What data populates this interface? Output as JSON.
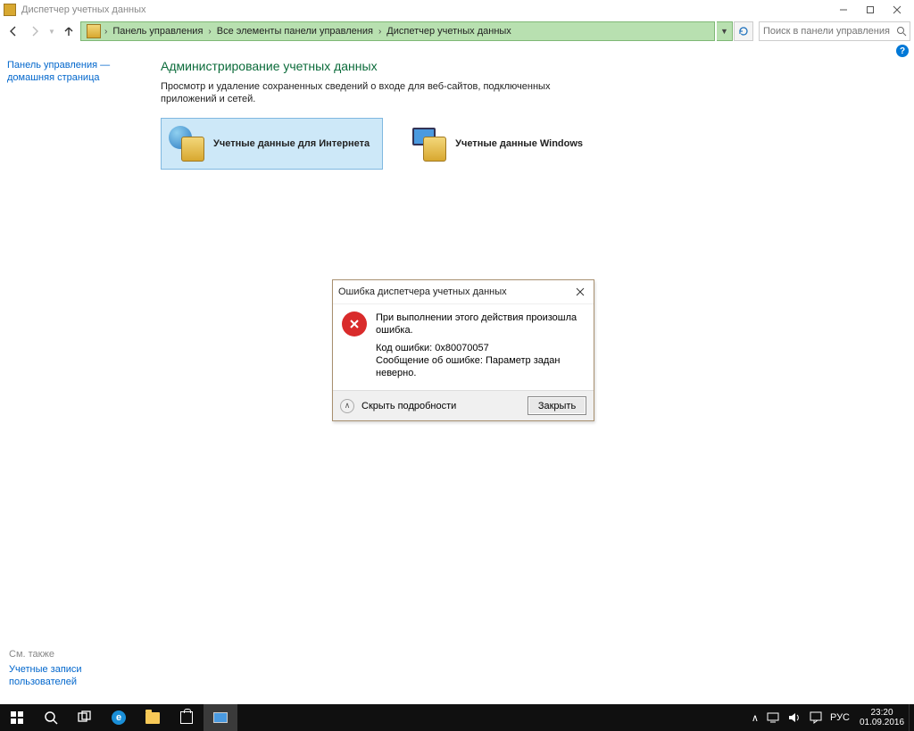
{
  "window": {
    "title": "Диспетчер учетных данных"
  },
  "breadcrumb": {
    "items": [
      "Панель управления",
      "Все элементы панели управления",
      "Диспетчер учетных данных"
    ]
  },
  "search": {
    "placeholder": "Поиск в панели управления"
  },
  "sidebar": {
    "home_line1": "Панель управления —",
    "home_line2": "домашняя страница",
    "seealso_label": "См. также",
    "seealso_link_line1": "Учетные записи",
    "seealso_link_line2": "пользователей"
  },
  "main": {
    "heading": "Администрирование учетных данных",
    "description": "Просмотр и удаление сохраненных сведений о входе для веб-сайтов, подключенных приложений и сетей.",
    "tiles": [
      {
        "label": "Учетные данные для Интернета",
        "selected": true
      },
      {
        "label": "Учетные данные Windows",
        "selected": false
      }
    ]
  },
  "dialog": {
    "title": "Ошибка диспетчера учетных данных",
    "message": "При выполнении этого действия произошла ошибка.",
    "code_line": "Код ошибки: 0x80070057",
    "detail_line": "Сообщение об ошибке: Параметр задан неверно.",
    "hide_details": "Скрыть подробности",
    "close_btn": "Закрыть"
  },
  "tray": {
    "lang": "РУС",
    "time": "23:20",
    "date": "01.09.2016"
  }
}
